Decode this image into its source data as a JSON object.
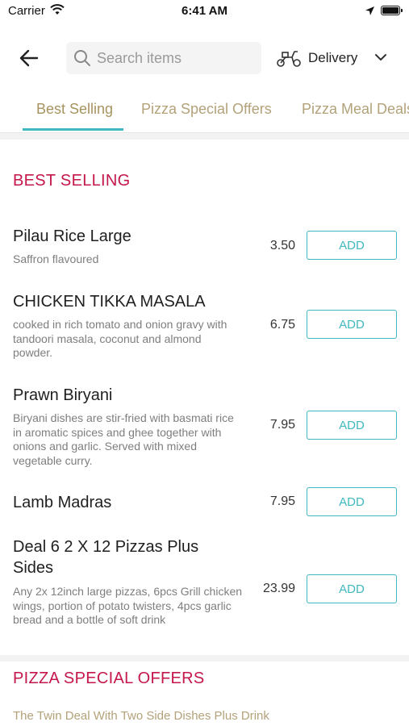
{
  "status_bar": {
    "carrier": "Carrier",
    "time": "6:41 AM"
  },
  "header": {
    "search_placeholder": "Search items",
    "delivery_label": "Delivery"
  },
  "tabs": [
    {
      "label": "Best Selling",
      "active": true
    },
    {
      "label": "Pizza Special Offers",
      "active": false
    },
    {
      "label": "Pizza Meal Deals",
      "active": false
    }
  ],
  "sections": [
    {
      "title": "BEST SELLING",
      "items": [
        {
          "name": "Pilau Rice Large",
          "description": "Saffron flavoured",
          "price": "3.50",
          "add_label": "ADD"
        },
        {
          "name": "CHICKEN TIKKA MASALA",
          "description": "cooked in rich tomato and onion gravy with tandoori masala, coconut and almond powder.",
          "price": "6.75",
          "add_label": "ADD"
        },
        {
          "name": "Prawn Biryani",
          "description": "Biryani dishes are stir-fried with basmati rice in aromatic spices and ghee together with onions and garlic. Served with mixed vegetable curry.",
          "price": "7.95",
          "add_label": "ADD"
        },
        {
          "name": "Lamb Madras",
          "description": "",
          "price": "7.95",
          "add_label": "ADD"
        },
        {
          "name": "Deal 6 2 X 12 Pizzas Plus Sides",
          "description": "Any 2x 12inch large pizzas, 6pcs Grill chicken wings, portion of potato twisters, 4pcs garlic bread and a bottle of soft drink",
          "price": "23.99",
          "add_label": "ADD"
        }
      ]
    },
    {
      "title": "PIZZA SPECIAL OFFERS",
      "items": [
        {
          "name": "The Twin Deal With Two Side Dishes Plus Drink"
        }
      ]
    }
  ]
}
